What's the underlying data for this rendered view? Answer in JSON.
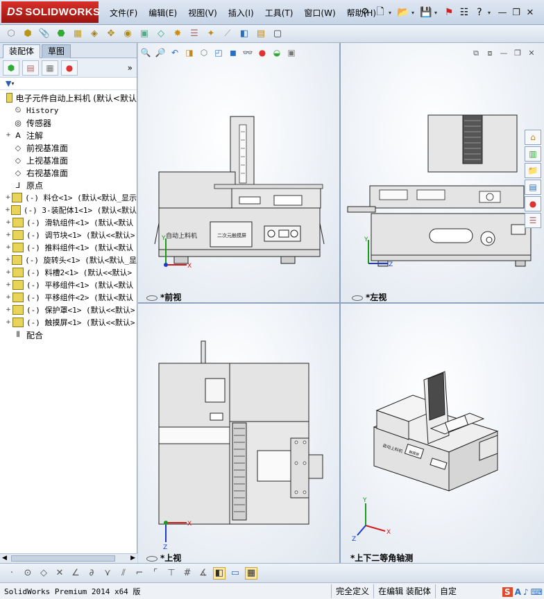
{
  "app": {
    "logo_text": "SOLIDWORKS",
    "logo_prefix": "DS",
    "menu": [
      "文件(F)",
      "编辑(E)",
      "视图(V)",
      "插入(I)",
      "工具(T)",
      "窗口(W)",
      "帮助(H)"
    ]
  },
  "panel": {
    "tabs": [
      "装配体",
      "草图"
    ],
    "tree_items": [
      {
        "expand": "",
        "icon": "assembly-icon",
        "label": "电子元件自动上料机  (默认<默认",
        "cn": true
      },
      {
        "expand": "",
        "icon": "history-icon",
        "label": "History",
        "cn": false
      },
      {
        "expand": "",
        "icon": "sensor-icon",
        "label": "传感器",
        "cn": true
      },
      {
        "expand": "+",
        "icon": "annotation-icon",
        "label": "注解",
        "cn": true
      },
      {
        "expand": "",
        "icon": "plane-icon",
        "label": "前视基准面",
        "cn": true
      },
      {
        "expand": "",
        "icon": "plane-icon",
        "label": "上视基准面",
        "cn": true
      },
      {
        "expand": "",
        "icon": "plane-icon",
        "label": "右视基准面",
        "cn": true
      },
      {
        "expand": "",
        "icon": "origin-icon",
        "label": "原点",
        "cn": true
      },
      {
        "expand": "+",
        "icon": "assembly-icon",
        "label": "(-) 料仓<1> (默认<默认_显示",
        "cn": false
      },
      {
        "expand": "+",
        "icon": "assembly-icon",
        "label": "(-) 3-装配体1<1> (默认<默认",
        "cn": false
      },
      {
        "expand": "+",
        "icon": "assembly-icon",
        "label": "(-) 滑轨组件<1> (默认<默认",
        "cn": false
      },
      {
        "expand": "+",
        "icon": "part-icon",
        "label": "(-) 调节块<1> (默认<<默认>",
        "cn": false
      },
      {
        "expand": "+",
        "icon": "assembly-icon",
        "label": "(-) 推料组件<1> (默认<默认",
        "cn": false
      },
      {
        "expand": "+",
        "icon": "assembly-icon",
        "label": "(-) 旋转头<1> (默认<默认_显",
        "cn": false
      },
      {
        "expand": "+",
        "icon": "part-icon",
        "label": "(-) 料槽2<1> (默认<<默认>",
        "cn": false
      },
      {
        "expand": "+",
        "icon": "assembly-icon",
        "label": "(-) 平移组件<1> (默认<默认",
        "cn": false
      },
      {
        "expand": "+",
        "icon": "assembly-icon",
        "label": "(-) 平移组件<2> (默认<默认",
        "cn": false
      },
      {
        "expand": "+",
        "icon": "part-icon",
        "label": "(-) 保护罩<1> (默认<<默认>",
        "cn": false
      },
      {
        "expand": "+",
        "icon": "part-icon",
        "label": "(-) 触摸屏<1> (默认<<默认>",
        "cn": false
      },
      {
        "expand": "",
        "icon": "mate-icon",
        "label": "配合",
        "cn": true
      }
    ]
  },
  "viewports": {
    "front": "*前视",
    "left": "*左视",
    "top": "*上视",
    "iso": "*上下二等角轴测"
  },
  "model_text": {
    "front_label1": "自动上料机",
    "front_label2": "二次元触摸屏",
    "iso_label1": "自动上料机",
    "iso_label2": "触摸屏"
  },
  "axes": {
    "x": "X",
    "y": "Y",
    "z": "Z"
  },
  "status": {
    "product": "SolidWorks Premium 2014 x64 版",
    "cells": [
      "完全定义",
      "在编辑 装配体",
      "自定"
    ]
  },
  "ime": [
    "S",
    "A",
    "♪",
    "⌨"
  ],
  "colors": {
    "accent": "#c4221a",
    "axis_x": "#d21818",
    "axis_y": "#1a9a1a",
    "axis_z": "#1a3cc8",
    "model_body": "#e4e4e4"
  }
}
